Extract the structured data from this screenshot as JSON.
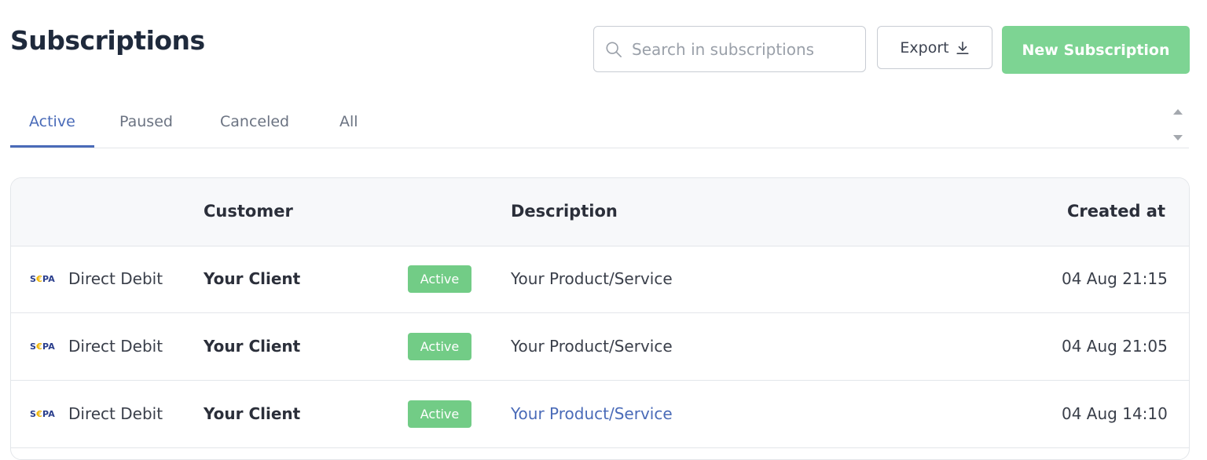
{
  "page": {
    "title": "Subscriptions"
  },
  "search": {
    "placeholder": "Search in subscriptions",
    "value": ""
  },
  "actions": {
    "export_label": "Export",
    "new_label": "New Subscription"
  },
  "tabs": [
    {
      "label": "Active",
      "active": true
    },
    {
      "label": "Paused",
      "active": false
    },
    {
      "label": "Canceled",
      "active": false
    },
    {
      "label": "All",
      "active": false
    }
  ],
  "table": {
    "headers": {
      "customer": "Customer",
      "description": "Description",
      "created": "Created at"
    },
    "rows": [
      {
        "method_logo": "SEPA",
        "method": "Direct Debit",
        "customer": "Your Client",
        "status": "Active",
        "description": "Your Product/Service",
        "created": "04 Aug 21:15"
      },
      {
        "method_logo": "SEPA",
        "method": "Direct Debit",
        "customer": "Your Client",
        "status": "Active",
        "description": "Your Product/Service",
        "created": "04 Aug 21:05"
      },
      {
        "method_logo": "SEPA",
        "method": "Direct Debit",
        "customer": "Your Client",
        "status": "Active",
        "description": "Your Product/Service",
        "created": "04 Aug 14:10"
      }
    ]
  },
  "colors": {
    "accent": "#4a6bb8",
    "primary_button": "#7dd493",
    "status_active": "#72cc86"
  }
}
